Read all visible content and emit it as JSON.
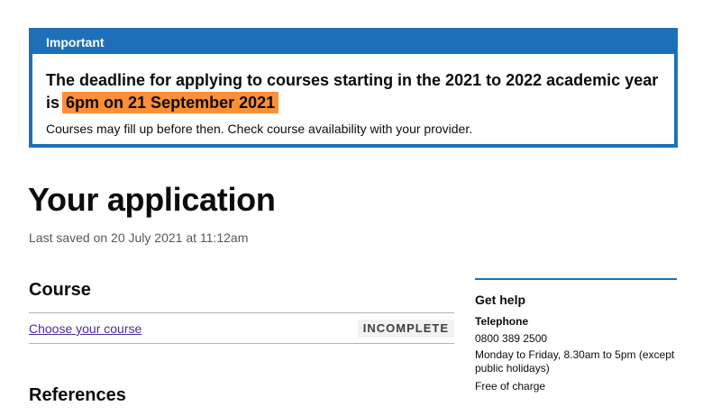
{
  "banner": {
    "title": "Important",
    "heading": "The deadline for applying to courses starting in the 2021 to 2022 academic year is",
    "deadline": "6pm on 21 September 2021",
    "body": "Courses may fill up before then. Check course availability with your provider."
  },
  "page": {
    "title": "Your application",
    "last_saved": "Last saved on 20 July 2021 at 11:12am"
  },
  "sections": {
    "course": {
      "title": "Course",
      "link_label": "Choose your course",
      "status": "INCOMPLETE"
    },
    "references": {
      "title": "References"
    }
  },
  "help": {
    "title": "Get help",
    "telephone_label": "Telephone",
    "phone": "0800 389 2500",
    "hours": "Monday to Friday, 8.30am to 5pm (except public holidays)",
    "cost": "Free of charge"
  },
  "colors": {
    "accent": "#1d70b8",
    "highlight": "#ff8f36",
    "link": "#4c2c92",
    "tag_bg": "#f3f2f1"
  }
}
